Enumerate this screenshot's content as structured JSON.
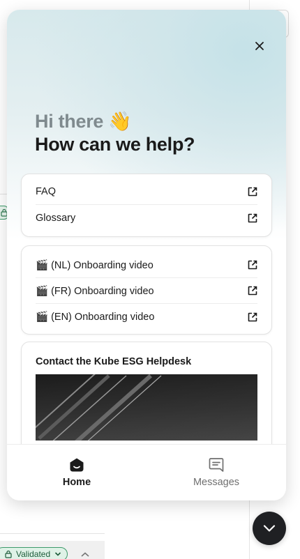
{
  "messenger": {
    "greeting": "Hi there 👋",
    "headline": "How can we help?",
    "resource_links": [
      {
        "label": "FAQ"
      },
      {
        "label": "Glossary"
      }
    ],
    "video_links": [
      {
        "label": "🎬 (NL) Onboarding video"
      },
      {
        "label": "🎬 (FR) Onboarding video"
      },
      {
        "label": "🎬 (EN) Onboarding video"
      }
    ],
    "contact_title": "Contact the Kube ESG Helpdesk",
    "tabs": [
      {
        "label": "Home",
        "icon": "home-icon",
        "active": true
      },
      {
        "label": "Messages",
        "icon": "messages-icon",
        "active": false
      }
    ]
  },
  "background": {
    "status_chip_label": "Validated"
  },
  "colors": {
    "launcher": "#1f2023",
    "hero_tint": "#c5e2e8",
    "validated_border": "#3d9a6a",
    "greeting_muted": "#7f8a8e"
  }
}
